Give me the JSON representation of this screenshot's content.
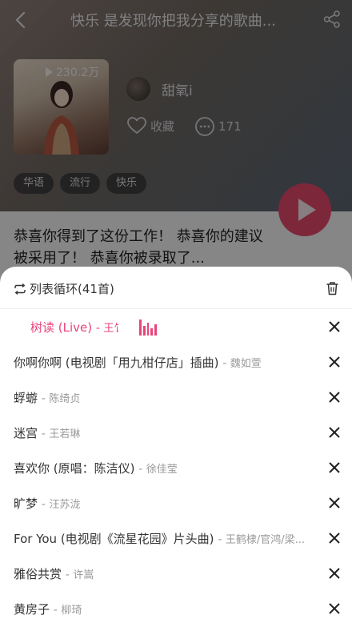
{
  "playlist": {
    "title": "快乐 是发现你把我分享的歌曲...",
    "play_count": "230.2万",
    "creator": "甜氧i",
    "favorite_label": "收藏",
    "comment_count": "171",
    "tags": [
      "华语",
      "流行",
      "快乐"
    ],
    "description": "恭喜你得到了这份工作！ 恭喜你的建议被采用了！ 恭喜你被录取了..."
  },
  "sheet": {
    "mode_label": "列表循环(41首)",
    "songs": [
      {
        "title": "树读 (Live)",
        "artist": "王饣",
        "active": true
      },
      {
        "title": "你啊你啊 (电视剧「用九柑仔店」插曲)",
        "artist": "魏如萱"
      },
      {
        "title": "蜉蝣",
        "artist": "陈绮贞"
      },
      {
        "title": "迷宫",
        "artist": "王若琳"
      },
      {
        "title": "喜欢你 (原唱：陈洁仪)",
        "artist": "徐佳莹"
      },
      {
        "title": "旷梦",
        "artist": "汪苏泷"
      },
      {
        "title": "For You (电视剧《流星花园》片头曲)",
        "artist": "王鹤棣/官鸿/梁..."
      },
      {
        "title": "雅俗共赏",
        "artist": "许嵩"
      },
      {
        "title": "黄房子",
        "artist": "柳琦"
      }
    ]
  },
  "colors": {
    "accent": "#e9447a",
    "play_button": "#e4476a"
  },
  "icons": [
    "back-arrow-icon",
    "share-icon",
    "heart-icon",
    "comment-icon",
    "loop-icon",
    "trash-icon",
    "close-icon",
    "equalizer-icon"
  ]
}
